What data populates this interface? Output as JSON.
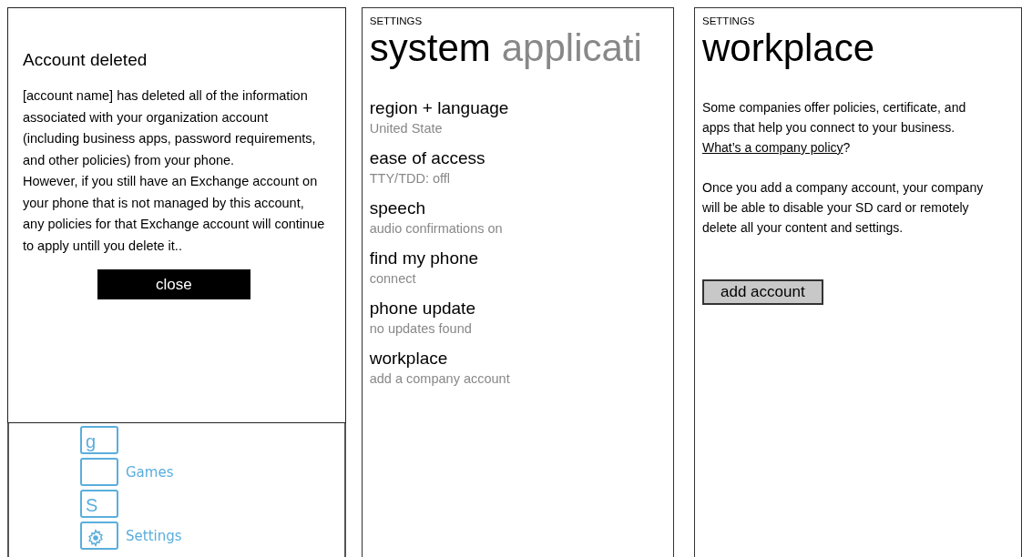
{
  "dialog": {
    "title": "Account deleted",
    "paragraphs": [
      "[account name] has deleted all of the information associated with your organization account (including business apps, password requirements, and other policies) from your phone.",
      "However, if you still have an Exchange account on your phone that is not managed by this account, any policies for that Exchange account will continue to apply untill you delete it.."
    ],
    "close_button": "close"
  },
  "app_list": [
    {
      "kind": "letter",
      "glyph": "g"
    },
    {
      "kind": "blank",
      "label": "Games"
    },
    {
      "kind": "letter",
      "glyph": "S"
    },
    {
      "kind": "gear",
      "label": "Settings"
    }
  ],
  "system_screen": {
    "header": "SETTINGS",
    "title": "system",
    "next_pivot": "applicati",
    "items": [
      {
        "title": "region + language",
        "subtitle": "United State"
      },
      {
        "title": "ease of access",
        "subtitle": "TTY/TDD: offl"
      },
      {
        "title": "speech",
        "subtitle": "audio confirmations on"
      },
      {
        "title": "find my phone",
        "subtitle": "connect"
      },
      {
        "title": "phone update",
        "subtitle": "no updates found"
      },
      {
        "title": "workplace",
        "subtitle": "add a company account"
      }
    ]
  },
  "workplace_screen": {
    "header": "SETTINGS",
    "title": "workplace",
    "intro": "Some companies offer policies, certificate, and apps that help you connect to your business.",
    "link": "What’s a company policy",
    "after_link": "?",
    "body": "Once you add a company account, your company will be able to disable your SD card or remotely delete all your content and settings.",
    "button": "add account"
  }
}
